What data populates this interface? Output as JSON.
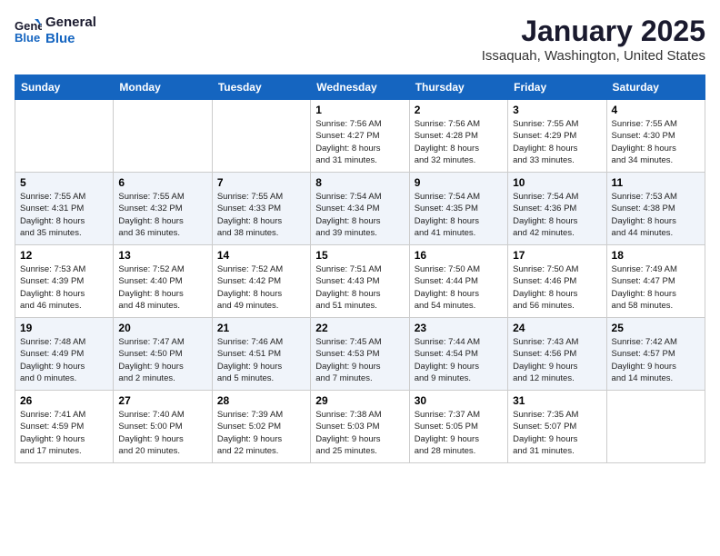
{
  "header": {
    "logo_line1": "General",
    "logo_line2": "Blue",
    "month": "January 2025",
    "location": "Issaquah, Washington, United States"
  },
  "weekdays": [
    "Sunday",
    "Monday",
    "Tuesday",
    "Wednesday",
    "Thursday",
    "Friday",
    "Saturday"
  ],
  "weeks": [
    [
      {
        "day": "",
        "info": ""
      },
      {
        "day": "",
        "info": ""
      },
      {
        "day": "",
        "info": ""
      },
      {
        "day": "1",
        "info": "Sunrise: 7:56 AM\nSunset: 4:27 PM\nDaylight: 8 hours\nand 31 minutes."
      },
      {
        "day": "2",
        "info": "Sunrise: 7:56 AM\nSunset: 4:28 PM\nDaylight: 8 hours\nand 32 minutes."
      },
      {
        "day": "3",
        "info": "Sunrise: 7:55 AM\nSunset: 4:29 PM\nDaylight: 8 hours\nand 33 minutes."
      },
      {
        "day": "4",
        "info": "Sunrise: 7:55 AM\nSunset: 4:30 PM\nDaylight: 8 hours\nand 34 minutes."
      }
    ],
    [
      {
        "day": "5",
        "info": "Sunrise: 7:55 AM\nSunset: 4:31 PM\nDaylight: 8 hours\nand 35 minutes."
      },
      {
        "day": "6",
        "info": "Sunrise: 7:55 AM\nSunset: 4:32 PM\nDaylight: 8 hours\nand 36 minutes."
      },
      {
        "day": "7",
        "info": "Sunrise: 7:55 AM\nSunset: 4:33 PM\nDaylight: 8 hours\nand 38 minutes."
      },
      {
        "day": "8",
        "info": "Sunrise: 7:54 AM\nSunset: 4:34 PM\nDaylight: 8 hours\nand 39 minutes."
      },
      {
        "day": "9",
        "info": "Sunrise: 7:54 AM\nSunset: 4:35 PM\nDaylight: 8 hours\nand 41 minutes."
      },
      {
        "day": "10",
        "info": "Sunrise: 7:54 AM\nSunset: 4:36 PM\nDaylight: 8 hours\nand 42 minutes."
      },
      {
        "day": "11",
        "info": "Sunrise: 7:53 AM\nSunset: 4:38 PM\nDaylight: 8 hours\nand 44 minutes."
      }
    ],
    [
      {
        "day": "12",
        "info": "Sunrise: 7:53 AM\nSunset: 4:39 PM\nDaylight: 8 hours\nand 46 minutes."
      },
      {
        "day": "13",
        "info": "Sunrise: 7:52 AM\nSunset: 4:40 PM\nDaylight: 8 hours\nand 48 minutes."
      },
      {
        "day": "14",
        "info": "Sunrise: 7:52 AM\nSunset: 4:42 PM\nDaylight: 8 hours\nand 49 minutes."
      },
      {
        "day": "15",
        "info": "Sunrise: 7:51 AM\nSunset: 4:43 PM\nDaylight: 8 hours\nand 51 minutes."
      },
      {
        "day": "16",
        "info": "Sunrise: 7:50 AM\nSunset: 4:44 PM\nDaylight: 8 hours\nand 54 minutes."
      },
      {
        "day": "17",
        "info": "Sunrise: 7:50 AM\nSunset: 4:46 PM\nDaylight: 8 hours\nand 56 minutes."
      },
      {
        "day": "18",
        "info": "Sunrise: 7:49 AM\nSunset: 4:47 PM\nDaylight: 8 hours\nand 58 minutes."
      }
    ],
    [
      {
        "day": "19",
        "info": "Sunrise: 7:48 AM\nSunset: 4:49 PM\nDaylight: 9 hours\nand 0 minutes."
      },
      {
        "day": "20",
        "info": "Sunrise: 7:47 AM\nSunset: 4:50 PM\nDaylight: 9 hours\nand 2 minutes."
      },
      {
        "day": "21",
        "info": "Sunrise: 7:46 AM\nSunset: 4:51 PM\nDaylight: 9 hours\nand 5 minutes."
      },
      {
        "day": "22",
        "info": "Sunrise: 7:45 AM\nSunset: 4:53 PM\nDaylight: 9 hours\nand 7 minutes."
      },
      {
        "day": "23",
        "info": "Sunrise: 7:44 AM\nSunset: 4:54 PM\nDaylight: 9 hours\nand 9 minutes."
      },
      {
        "day": "24",
        "info": "Sunrise: 7:43 AM\nSunset: 4:56 PM\nDaylight: 9 hours\nand 12 minutes."
      },
      {
        "day": "25",
        "info": "Sunrise: 7:42 AM\nSunset: 4:57 PM\nDaylight: 9 hours\nand 14 minutes."
      }
    ],
    [
      {
        "day": "26",
        "info": "Sunrise: 7:41 AM\nSunset: 4:59 PM\nDaylight: 9 hours\nand 17 minutes."
      },
      {
        "day": "27",
        "info": "Sunrise: 7:40 AM\nSunset: 5:00 PM\nDaylight: 9 hours\nand 20 minutes."
      },
      {
        "day": "28",
        "info": "Sunrise: 7:39 AM\nSunset: 5:02 PM\nDaylight: 9 hours\nand 22 minutes."
      },
      {
        "day": "29",
        "info": "Sunrise: 7:38 AM\nSunset: 5:03 PM\nDaylight: 9 hours\nand 25 minutes."
      },
      {
        "day": "30",
        "info": "Sunrise: 7:37 AM\nSunset: 5:05 PM\nDaylight: 9 hours\nand 28 minutes."
      },
      {
        "day": "31",
        "info": "Sunrise: 7:35 AM\nSunset: 5:07 PM\nDaylight: 9 hours\nand 31 minutes."
      },
      {
        "day": "",
        "info": ""
      }
    ]
  ]
}
